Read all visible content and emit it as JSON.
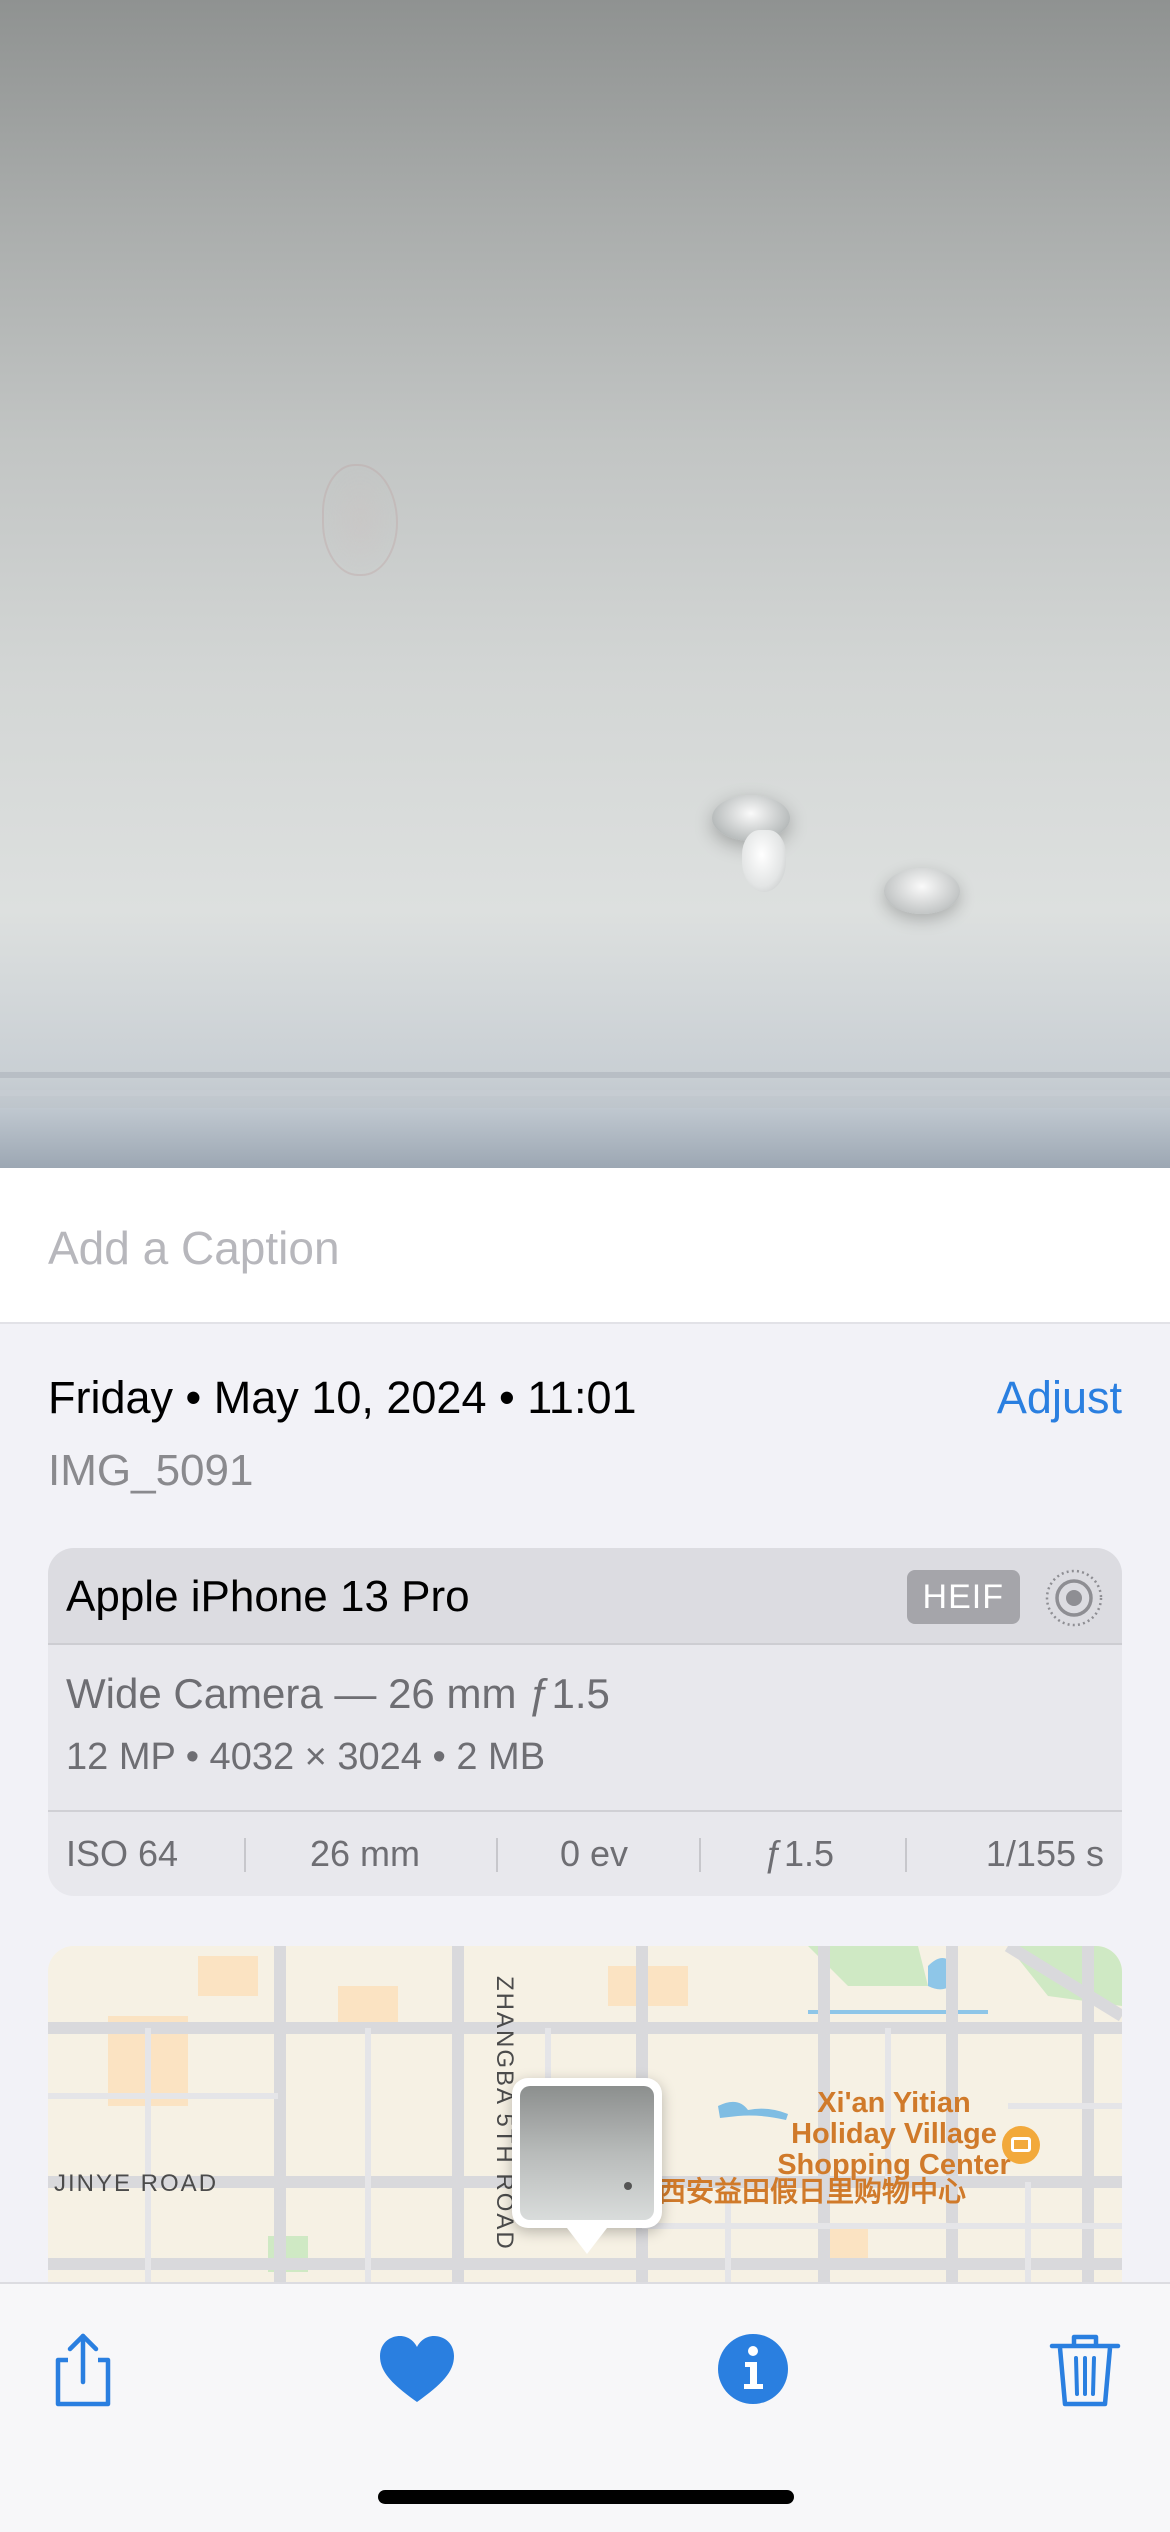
{
  "caption": {
    "placeholder": "Add a Caption",
    "value": ""
  },
  "info": {
    "date_line": "Friday • May 10, 2024 • 11:01",
    "adjust_label": "Adjust",
    "file_name": "IMG_5091"
  },
  "camera": {
    "device": "Apple iPhone 13 Pro",
    "format_badge": "HEIF",
    "lens": "Wide Camera — 26 mm ƒ1.5",
    "specs": "12 MP  •  4032 × 3024  •  2 MB",
    "exif": [
      {
        "name": "iso",
        "label": "ISO 64"
      },
      {
        "name": "focal-length",
        "label": "26 mm"
      },
      {
        "name": "exposure-value",
        "label": "0 ev"
      },
      {
        "name": "aperture",
        "label": "ƒ1.5"
      },
      {
        "name": "shutter-speed",
        "label": "1/155 s"
      }
    ]
  },
  "map": {
    "road_left": "JINYE ROAD",
    "road_vertical": "ZHANGBA 5TH ROAD",
    "poi_name": "Xi'an Yitian Holiday Village Shopping Center",
    "poi_name_lines": [
      "Xi'an Yitian",
      "Holiday Village",
      "Shopping Center"
    ],
    "poi_name_cn": "西安益田假日里购物中心",
    "poi_icon": "shopping-bag-icon"
  },
  "toolbar": {
    "icons": [
      "share-icon",
      "heart-icon",
      "info-icon",
      "trash-icon"
    ],
    "accent_color": "#2a7fe0"
  }
}
